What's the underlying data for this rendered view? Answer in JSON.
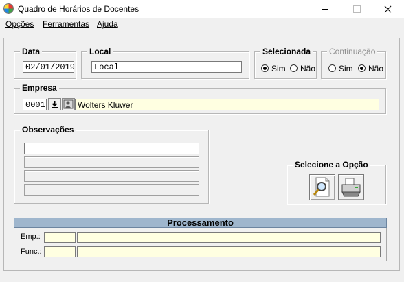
{
  "window": {
    "title": "Quadro de Horários de Docentes"
  },
  "menu": [
    {
      "label": "Opções",
      "hotkey_index": 0
    },
    {
      "label": "Ferramentas",
      "hotkey_index": 0
    },
    {
      "label": "Ajuda",
      "hotkey_index": 0
    }
  ],
  "data_group": {
    "title": "Data",
    "value": "02/01/2019"
  },
  "local_group": {
    "title": "Local",
    "value": "Local"
  },
  "selecionada": {
    "title": "Selecionada",
    "options": [
      "Sim",
      "Não"
    ],
    "selected": "Sim"
  },
  "continuacao": {
    "title": "Continuação",
    "options": [
      "Sim",
      "Não"
    ],
    "selected": "Não",
    "disabled": true
  },
  "empresa": {
    "title": "Empresa",
    "code": "0001",
    "name": "Wolters Kluwer"
  },
  "observacoes": {
    "title": "Observações",
    "lines": [
      "",
      "",
      "",
      ""
    ]
  },
  "selecione": {
    "title": "Selecione a Opção",
    "buttons": [
      "search-icon",
      "printer-icon"
    ]
  },
  "processamento": {
    "title": "Processamento",
    "rows": [
      {
        "label": "Emp.:",
        "code": "",
        "value": ""
      },
      {
        "label": "Func.:",
        "code": "",
        "value": ""
      }
    ]
  }
}
